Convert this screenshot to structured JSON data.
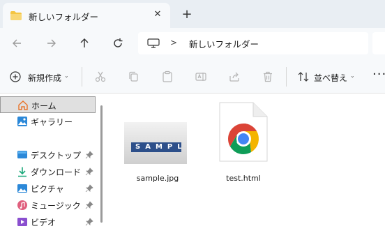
{
  "window": {
    "tab_title": "新しいフォルダー",
    "tab_close_glyph": "✕",
    "new_tab_glyph": "+"
  },
  "nav": {
    "back_icon": "arrow-left-icon",
    "forward_icon": "arrow-right-icon",
    "up_icon": "arrow-up-icon",
    "refresh_icon": "refresh-icon",
    "address": {
      "separator": ">",
      "folder_name": "新しいフォルダー"
    }
  },
  "toolbar": {
    "new_label": "新規作成",
    "new_caret": "⌄",
    "sort_label": "並べ替え",
    "sort_caret": "⌄",
    "more_glyph": "···"
  },
  "sidebar": {
    "items": [
      {
        "label": "ホーム",
        "icon": "home-icon",
        "pinned": false,
        "selected": true
      },
      {
        "label": "ギャラリー",
        "icon": "gallery-icon",
        "pinned": false,
        "selected": false
      },
      {
        "label": "デスクトップ",
        "icon": "desktop-icon",
        "pinned": true,
        "selected": false
      },
      {
        "label": "ダウンロード",
        "icon": "download-icon",
        "pinned": true,
        "selected": false
      },
      {
        "label": "ピクチャ",
        "icon": "pictures-icon",
        "pinned": true,
        "selected": false
      },
      {
        "label": "ミュージック",
        "icon": "music-icon",
        "pinned": true,
        "selected": false
      },
      {
        "label": "ビデオ",
        "icon": "video-icon",
        "pinned": true,
        "selected": false
      }
    ]
  },
  "files": [
    {
      "name": "sample.jpg",
      "type": "image",
      "thumbnail_text": "SAMPLE"
    },
    {
      "name": "test.html",
      "type": "chrome-html"
    }
  ],
  "colors": {
    "folder_yellow": "#f4c542",
    "accent_blue": "#0067c0",
    "chrome_red": "#db4437",
    "chrome_yellow": "#f4b400",
    "chrome_green": "#0f9d58",
    "chrome_blue": "#4285f4"
  }
}
